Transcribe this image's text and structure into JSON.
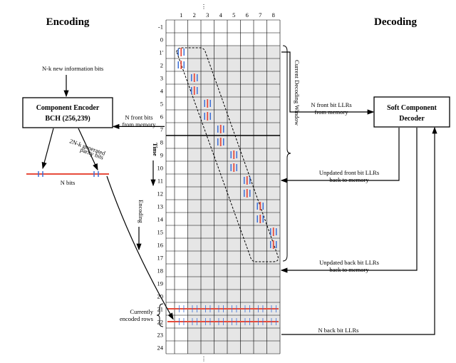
{
  "headings": {
    "encoding": "Encoding",
    "decoding": "Decoding"
  },
  "encoder": {
    "new_bits_label": "N-k new information bits",
    "box_line1": "Component Encoder",
    "box_line2": "BCH (256,239)",
    "parity_label": "2N-k generated\nparity bits",
    "n_bits_label": "N bits"
  },
  "memory": {
    "front_from": "N front bits\nfrom memory",
    "time_label": "Time",
    "encoding_label": "Encoding",
    "current_rows_label": "Currently\nencoded rows"
  },
  "decoder": {
    "box_line1": "Soft Component",
    "box_line2": "Decoder",
    "front_llrs": "N front bit LLRs\nfrom memory",
    "window_label": "Current Decoding Window",
    "updated_front": "Unpdated front bit LLRs\nback to memory",
    "updated_back": "Unpdated back bit LLRs\nback to memory",
    "back_llrs": "N back bit LLRs"
  },
  "grid": {
    "cols": [
      1,
      2,
      3,
      4,
      5,
      6,
      7,
      8
    ],
    "row_labels_top": [
      -1,
      0,
      "1'",
      2,
      3,
      4,
      5,
      6,
      7
    ],
    "row_labels_lower": [
      8,
      9,
      10,
      11,
      12,
      13,
      14,
      15,
      16,
      17,
      18,
      19,
      20,
      21,
      22,
      23,
      24
    ],
    "total_rows": 26
  },
  "chart_data": {
    "type": "diagram-grid",
    "description": "Encoding/decoding memory grid for a staircase-like product code. Rows represent time instants, columns represent bit positions. Encoder writes N-bit rows (currently rows 21–22). Decoder operates on a sliding diagonal window spanning roughly rows 1–17 across columns 1–8.",
    "grid_rows": 26,
    "grid_cols": 8,
    "shaded_row_range": [
      2,
      25
    ],
    "white_columns_left": 1,
    "encoder_current_rows": [
      21,
      22
    ],
    "decoding_window_rows": [
      1,
      17
    ],
    "ticks": [
      {
        "row": 1,
        "col": 1
      },
      {
        "row": 2,
        "col": 1
      },
      {
        "row": 3,
        "col": 2
      },
      {
        "row": 4,
        "col": 2
      },
      {
        "row": 5,
        "col": 3
      },
      {
        "row": 6,
        "col": 3
      },
      {
        "row": 7,
        "col": 4
      },
      {
        "row": 8,
        "col": 4
      },
      {
        "row": 9,
        "col": 5
      },
      {
        "row": 10,
        "col": 5
      },
      {
        "row": 11,
        "col": 6
      },
      {
        "row": 12,
        "col": 6
      },
      {
        "row": 13,
        "col": 7
      },
      {
        "row": 14,
        "col": 7
      },
      {
        "row": 15,
        "col": 8
      },
      {
        "row": 16,
        "col": 8
      }
    ],
    "encoder": {
      "type": "BCH",
      "n": 256,
      "k": 239,
      "info_bits": "N-k",
      "parity_bits": "2N-k",
      "row_width": "N"
    }
  }
}
